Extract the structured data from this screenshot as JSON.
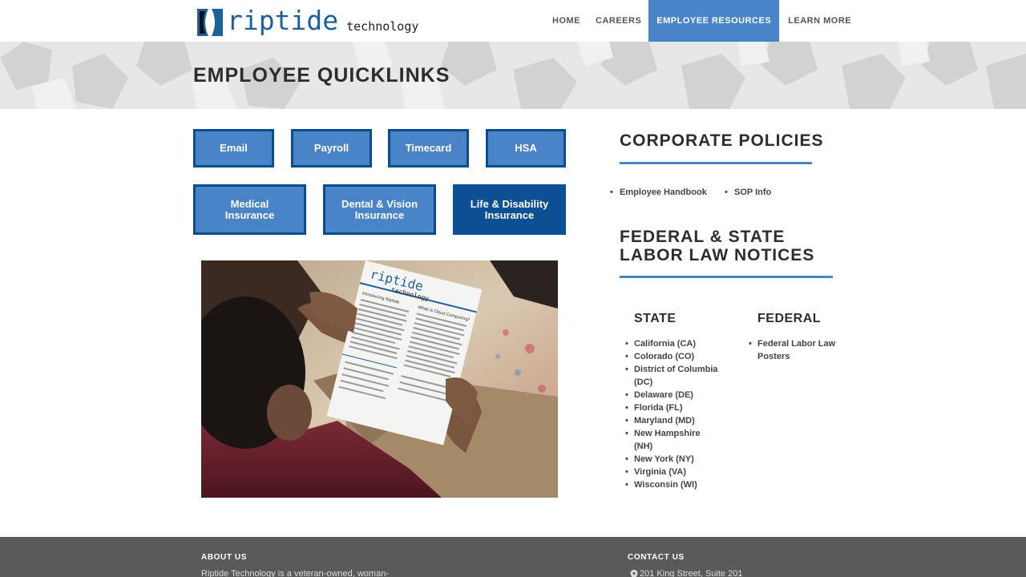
{
  "header": {
    "logo_word": "riptide",
    "logo_sub": "technology",
    "nav": [
      {
        "label": "HOME"
      },
      {
        "label": "CAREERS"
      },
      {
        "label": "EMPLOYEE RESOURCES"
      },
      {
        "label": "LEARN MORE"
      }
    ]
  },
  "banner": {
    "title": "EMPLOYEE QUICKLINKS"
  },
  "quicklinks": [
    {
      "label": "Email"
    },
    {
      "label": "Payroll"
    },
    {
      "label": "Timecard"
    },
    {
      "label": "HSA"
    },
    {
      "label_line1": "Medical",
      "label_line2": "Insurance"
    },
    {
      "label_line1": "Dental & Vision",
      "label_line2": "Insurance"
    },
    {
      "label_line1": "Life & Disability",
      "label_line2": "Insurance"
    }
  ],
  "photo": {
    "newsletter_word": "riptide",
    "newsletter_sub": "technology",
    "col1_title": "Introducing Riptide",
    "col2_title": "What is Cloud Computing?"
  },
  "policies": {
    "title": "CORPORATE POLICIES",
    "links": [
      "Employee Handbook",
      "SOP Info"
    ]
  },
  "labor": {
    "title_line1": "FEDERAL & STATE",
    "title_line2": "LABOR LAW NOTICES",
    "state_title": "STATE",
    "federal_title": "FEDERAL",
    "state_items": [
      "California (CA)",
      "Colorado (CO)",
      "District of Columbia",
      "(DC)",
      "Delaware (DE)",
      "Florida (FL)",
      "Maryland (MD)",
      "New Hampshire",
      "(NH)",
      "New York (NY)",
      "Virginia (VA)",
      "Wisconsin (WI)"
    ],
    "federal_items": [
      "Federal Labor Law",
      "Posters"
    ]
  },
  "footer": {
    "about_title": "ABOUT US",
    "about_text": "Riptide Technology is a veteran-owned, woman-",
    "contact_title": "CONTACT US",
    "contact_text": "201 King Street, Suite 201"
  }
}
